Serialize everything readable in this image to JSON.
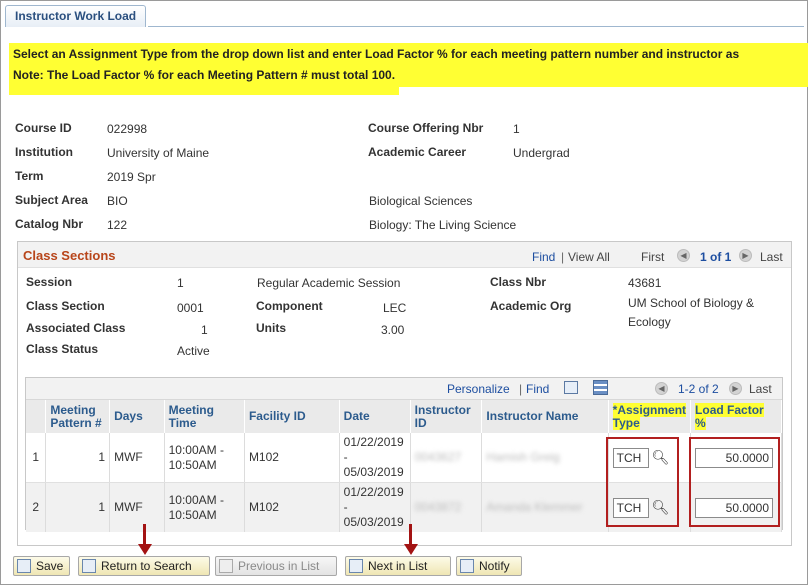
{
  "tab": {
    "label": "Instructor Work Load"
  },
  "instructions": {
    "line1": "Select an Assignment Type from the drop down list and enter Load Factor % for each meeting pattern number and instructor as appropriate.",
    "line2": "Note: The Load Factor % for each Meeting Pattern # must total 100."
  },
  "course": {
    "course_id_label": "Course ID",
    "course_id": "022998",
    "institution_label": "Institution",
    "institution": "University of Maine",
    "term_label": "Term",
    "term": "2019 Spr",
    "subject_label": "Subject Area",
    "subject": "BIO",
    "subject_desc": "Biological Sciences",
    "catalog_label": "Catalog Nbr",
    "catalog": "122",
    "catalog_desc": "Biology: The Living Science",
    "offering_label": "Course Offering Nbr",
    "offering": "1",
    "career_label": "Academic Career",
    "career": "Undergrad"
  },
  "class_sections": {
    "title": "Class Sections",
    "find": "Find",
    "view_all": "View All",
    "sep": "|",
    "first": "First",
    "pager": "1 of 1",
    "last": "Last",
    "session_label": "Session",
    "session": "1",
    "session_desc": "Regular Academic Session",
    "section_label": "Class Section",
    "section": "0001",
    "component_label": "Component",
    "component": "LEC",
    "assoc_label": "Associated Class",
    "assoc": "1",
    "units_label": "Units",
    "units": "3.00",
    "status_label": "Class Status",
    "status": "Active",
    "class_nbr_label": "Class Nbr",
    "class_nbr": "43681",
    "acad_org_label": "Academic Org",
    "acad_org_line1": "UM School of Biology &",
    "acad_org_line2": "Ecology"
  },
  "grid": {
    "personalize": "Personalize",
    "find": "Find",
    "sep": "|",
    "pager": "1-2 of 2",
    "last": "Last",
    "columns": [
      "Meeting Pattern #",
      "Days",
      "Meeting Time",
      "Facility ID",
      "Date",
      "Instructor ID",
      "Instructor Name",
      "*Assignment Type",
      "Load Factor %"
    ],
    "rows": [
      {
        "n": "1",
        "pattern": "1",
        "days": "MWF",
        "time1": "10:00AM -",
        "time2": "10:50AM",
        "facility": "M102",
        "date1": "01/22/2019",
        "date2": "-",
        "date3": "05/03/2019",
        "instr_id": "0043627",
        "instr_name": "Hamish Greig",
        "assign": "TCH",
        "load": "50.0000"
      },
      {
        "n": "2",
        "pattern": "1",
        "days": "MWF",
        "time1": "10:00AM -",
        "time2": "10:50AM",
        "facility": "M102",
        "date1": "01/22/2019",
        "date2": "-",
        "date3": "05/03/2019",
        "instr_id": "0043872",
        "instr_name": "Amanda Klemmer",
        "assign": "TCH",
        "load": "50.0000"
      }
    ]
  },
  "buttons": {
    "save": "Save",
    "return": "Return to Search",
    "previous": "Previous in List",
    "next": "Next in List",
    "notify": "Notify"
  },
  "colors": {
    "highlight": "#ffff33",
    "annotation_red": "#a31313",
    "link": "#1d4ea0",
    "header_text": "#2c5b8d"
  }
}
